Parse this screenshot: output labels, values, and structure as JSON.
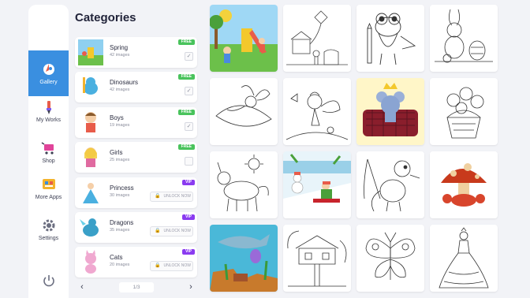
{
  "nav": {
    "items": [
      {
        "label": "Gallery",
        "icon": "gallery-icon"
      },
      {
        "label": "My Works",
        "icon": "brush-icon"
      },
      {
        "label": "Shop",
        "icon": "cart-icon"
      },
      {
        "label": "More Apps",
        "icon": "apps-icon"
      },
      {
        "label": "Settings",
        "icon": "gear-icon"
      }
    ],
    "power_icon": "power-icon",
    "active_color": "#3a8fe0"
  },
  "categories": {
    "title": "Categories",
    "items": [
      {
        "name": "Spring",
        "count": "42 images",
        "badge": "FREE",
        "checked": true
      },
      {
        "name": "Dinosaurs",
        "count": "42 images",
        "badge": "FREE",
        "checked": true
      },
      {
        "name": "Boys",
        "count": "19 images",
        "badge": "FREE",
        "checked": true
      },
      {
        "name": "Girls",
        "count": "25 images",
        "badge": "FREE",
        "checked": false
      },
      {
        "name": "Princess",
        "count": "30 images",
        "badge": "VIP",
        "action": "UNLOCK NOW"
      },
      {
        "name": "Dragons",
        "count": "35 images",
        "badge": "VIP",
        "action": "UNLOCK NOW"
      },
      {
        "name": "Cats",
        "count": "20 images",
        "badge": "VIP",
        "action": "UNLOCK NOW"
      }
    ],
    "pager": {
      "current": "1/3",
      "prev": "‹",
      "next": "›"
    }
  },
  "gallery": {
    "tiles": [
      "spring-playground-colored",
      "kite-house-lineart",
      "dinosaur-pencil-lineart",
      "easter-bunny-lineart",
      "fairy-leaf-lineart",
      "fairy-flying-lineart",
      "mouse-king-sofa-colored",
      "flower-basket-lineart",
      "unicorn-sun-lineart",
      "winter-sled-colored",
      "dragon-fisherman-lineart",
      "mushroom-crab-colored",
      "shark-underwater-colored",
      "treehouse-lineart",
      "butterfly-lineart",
      "princess-dress-lineart"
    ]
  },
  "colors": {
    "free": "#49c35c",
    "vip": "#8a3bf0"
  }
}
